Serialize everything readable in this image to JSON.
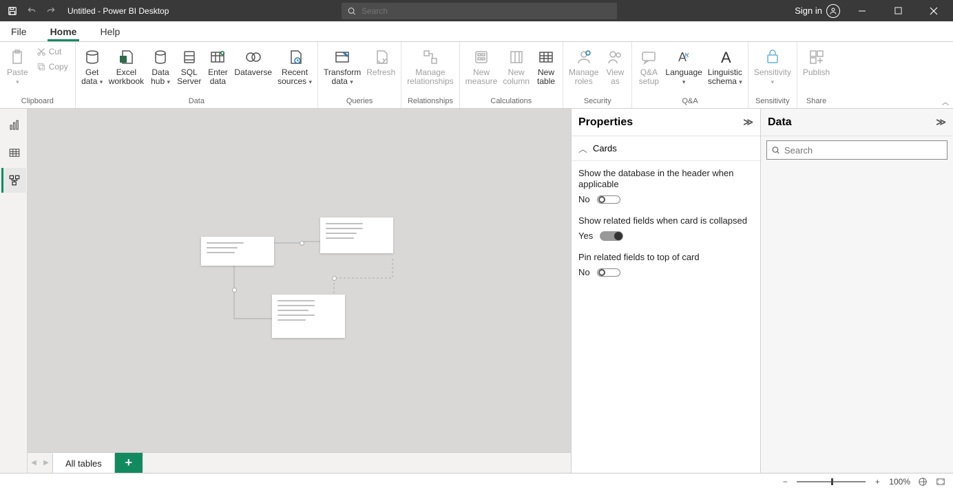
{
  "titlebar": {
    "title": "Untitled - Power BI Desktop",
    "search_placeholder": "Search",
    "signin": "Sign in"
  },
  "menutabs": {
    "file": "File",
    "home": "Home",
    "help": "Help"
  },
  "ribbon": {
    "clipboard": {
      "paste": "Paste",
      "cut": "Cut",
      "copy": "Copy",
      "label": "Clipboard"
    },
    "data": {
      "getdata": "Get\ndata",
      "excel": "Excel\nworkbook",
      "datahub": "Data\nhub",
      "sql": "SQL\nServer",
      "enter": "Enter\ndata",
      "dataverse": "Dataverse",
      "recent": "Recent\nsources",
      "label": "Data"
    },
    "queries": {
      "transform": "Transform\ndata",
      "refresh": "Refresh",
      "label": "Queries"
    },
    "relationships": {
      "manage": "Manage\nrelationships",
      "label": "Relationships"
    },
    "calculations": {
      "measure": "New\nmeasure",
      "column": "New\ncolumn",
      "table": "New\ntable",
      "label": "Calculations"
    },
    "security": {
      "roles": "Manage\nroles",
      "viewas": "View\nas",
      "label": "Security"
    },
    "qa": {
      "setup": "Q&A\nsetup",
      "language": "Language\n",
      "schema": "Linguistic\nschema",
      "label": "Q&A"
    },
    "sensitivity": {
      "btn": "Sensitivity\n",
      "label": "Sensitivity"
    },
    "share": {
      "publish": "Publish",
      "label": "Share"
    }
  },
  "tabbar": {
    "alltables": "All tables"
  },
  "properties": {
    "title": "Properties",
    "section_cards": "Cards",
    "show_db": {
      "label": "Show the database in the header when applicable",
      "state": "No"
    },
    "show_related": {
      "label": "Show related fields when card is collapsed",
      "state": "Yes"
    },
    "pin_related": {
      "label": "Pin related fields to top of card",
      "state": "No"
    }
  },
  "data_pane": {
    "title": "Data",
    "search_placeholder": "Search"
  },
  "statusbar": {
    "zoom": "100%"
  }
}
